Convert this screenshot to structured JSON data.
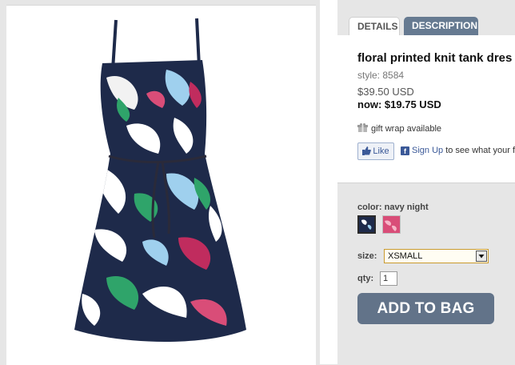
{
  "tabs": {
    "details_label": "DETAILS",
    "description_label": "DESCRIPTION"
  },
  "product": {
    "title": "floral printed knit tank dres",
    "style": "style: 8584",
    "price": "$39.50 USD",
    "sale_price": "now: $19.75 USD",
    "gift_wrap": "gift wrap available"
  },
  "social": {
    "like_label": "Like",
    "signup_link": "Sign Up",
    "signup_text": " to see what your f"
  },
  "options": {
    "color_label": "color: navy night",
    "size_label": "size:",
    "size_value": "XSMALL",
    "qty_label": "qty:",
    "qty_value": "1"
  },
  "cart": {
    "add_label": "ADD TO BAG"
  },
  "colors": {
    "tab_active": "#667a91",
    "button": "#627389",
    "navy": "#1e2a4a",
    "pink": "#d94d78"
  }
}
